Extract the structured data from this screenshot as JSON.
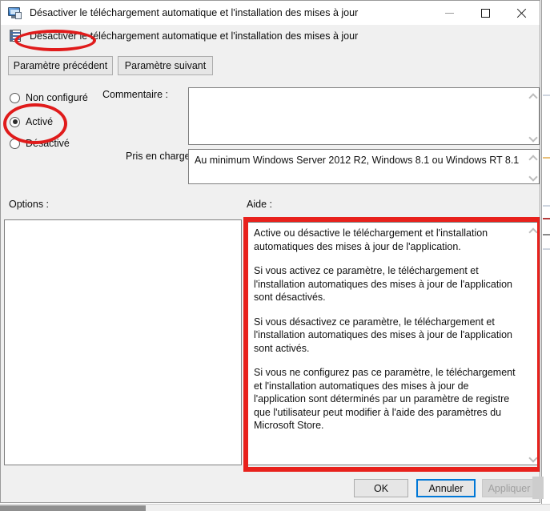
{
  "window": {
    "title": "Désactiver le téléchargement automatique et l'installation des mises à jour",
    "icon": "computer-monitor-icon",
    "controls": {
      "minimize": "minimize-icon",
      "maximize": "maximize-icon",
      "close": "close-icon"
    }
  },
  "policy_header": {
    "icon": "policy-setting-icon",
    "title": "Désactiver le téléchargement automatique et l'installation des mises à jour"
  },
  "navigation": {
    "previous_label": "Paramètre précédent",
    "next_label": "Paramètre suivant"
  },
  "state_options": {
    "items": [
      {
        "label": "Non configuré",
        "selected": false
      },
      {
        "label": "Activé",
        "selected": true
      },
      {
        "label": "Désactivé",
        "selected": false
      }
    ]
  },
  "comment": {
    "label": "Commentaire :",
    "value": "",
    "placeholder": ""
  },
  "supported_on": {
    "label": "Pris en charge sur :",
    "value": "Au minimum Windows Server 2012 R2, Windows 8.1 ou Windows RT 8.1"
  },
  "options_panel": {
    "label": "Options :",
    "content": ""
  },
  "help_panel": {
    "label": "Aide :",
    "paragraphs": [
      "Active ou désactive le téléchargement et l'installation automatiques des mises à jour de l'application.",
      "Si vous activez ce paramètre, le téléchargement et l'installation automatiques des mises à jour de l'application sont désactivés.",
      "Si vous désactivez ce paramètre, le téléchargement et l'installation automatiques des mises à jour de l'application sont activés.",
      "Si vous ne configurez pas ce paramètre, le téléchargement et l'installation automatiques des mises à jour de l'application sont déterminés par un paramètre de registre que l'utilisateur peut modifier à l'aide des paramètres du Microsoft Store."
    ]
  },
  "footer": {
    "ok_label": "OK",
    "cancel_label": "Annuler",
    "apply_label": "Appliquer",
    "apply_disabled": true,
    "cancel_focused": true
  },
  "annotations": {
    "accent_color": "#e01b1b",
    "shapes": [
      {
        "type": "ellipse",
        "target": "policy-header-title"
      },
      {
        "type": "ellipse",
        "target": "radio-enabled"
      },
      {
        "type": "rectangle",
        "target": "help-panel"
      }
    ]
  },
  "colors": {
    "dialog_background": "#f0f0f0",
    "field_background": "#ffffff",
    "focus_border": "#0078d7",
    "button_face": "#e6e6e6",
    "disabled_text": "#a0a0a0"
  }
}
